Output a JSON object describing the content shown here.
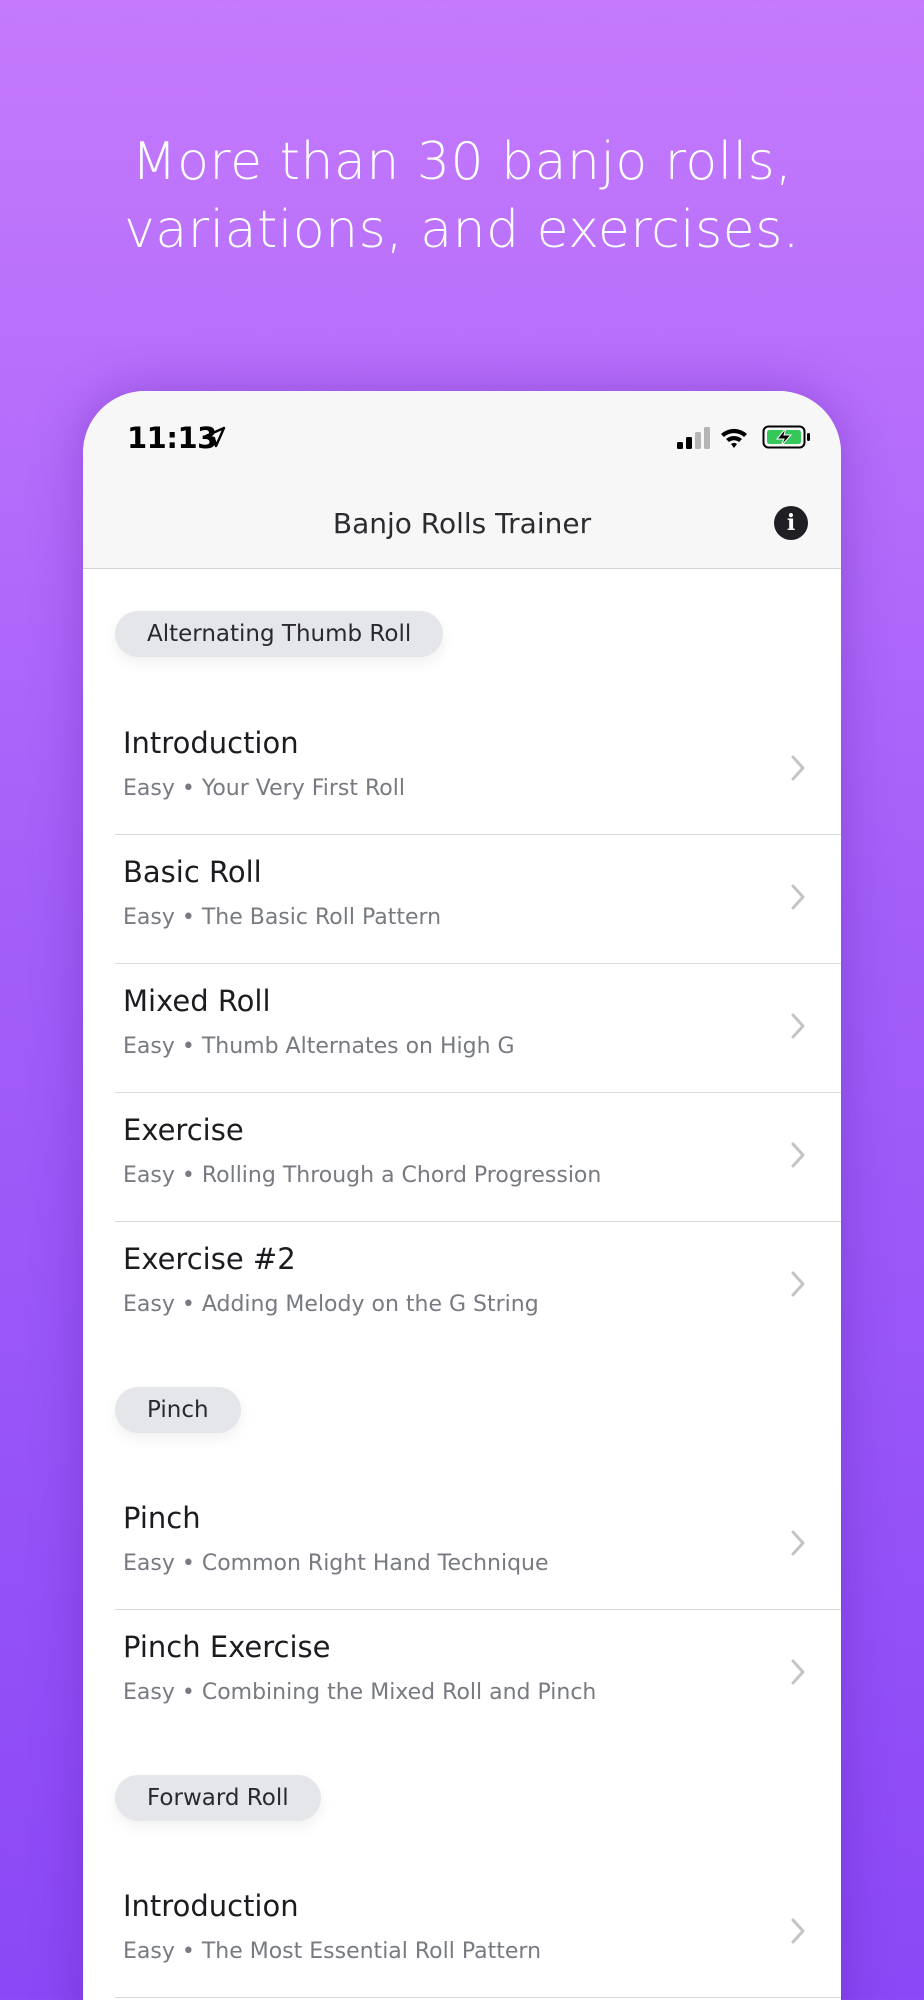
{
  "promo": {
    "headline_line1": "More than 30 banjo rolls,",
    "headline_line2": "variations, and exercises."
  },
  "status_bar": {
    "time": "11:13",
    "icons": [
      "location-arrow-icon",
      "signal-icon",
      "wifi-icon",
      "battery-charging-icon"
    ]
  },
  "nav": {
    "title": "Banjo Rolls Trainer",
    "info_icon": "info-icon"
  },
  "sections": [
    {
      "label": "Alternating Thumb Roll",
      "items": [
        {
          "title": "Introduction",
          "subtitle": "Easy • Your Very First Roll"
        },
        {
          "title": "Basic Roll",
          "subtitle": "Easy • The Basic Roll Pattern"
        },
        {
          "title": "Mixed Roll",
          "subtitle": "Easy • Thumb Alternates on High G"
        },
        {
          "title": "Exercise",
          "subtitle": "Easy • Rolling Through a Chord Progression"
        },
        {
          "title": "Exercise #2",
          "subtitle": "Easy • Adding Melody on the G String"
        }
      ]
    },
    {
      "label": "Pinch",
      "items": [
        {
          "title": "Pinch",
          "subtitle": "Easy • Common Right Hand Technique"
        },
        {
          "title": "Pinch Exercise",
          "subtitle": "Easy • Combining the Mixed Roll and Pinch"
        }
      ]
    },
    {
      "label": "Forward Roll",
      "items": [
        {
          "title": "Introduction",
          "subtitle": "Easy • The Most Essential Roll Pattern"
        }
      ]
    }
  ],
  "colors": {
    "background_top": "#c57afc",
    "background_bottom": "#8a48f6",
    "pill_background": "#e4e6ea",
    "subtitle_text": "#777a80"
  }
}
